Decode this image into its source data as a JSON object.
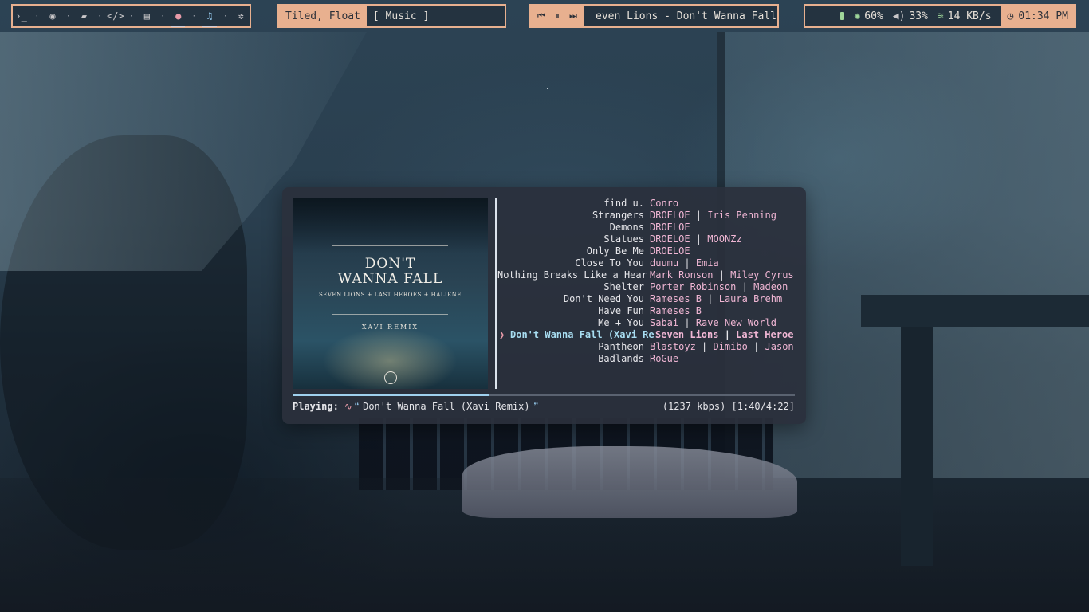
{
  "workspaces": {
    "items": [
      {
        "icon": "terminal-icon",
        "glyph": "›_"
      },
      {
        "icon": "browser-icon",
        "glyph": "◉"
      },
      {
        "icon": "folder-icon",
        "glyph": "▰"
      },
      {
        "icon": "code-icon",
        "glyph": "</>"
      },
      {
        "icon": "book-icon",
        "glyph": "▤"
      },
      {
        "icon": "chat-icon",
        "glyph": "●"
      },
      {
        "icon": "music-icon",
        "glyph": "♫"
      },
      {
        "icon": "gear-icon",
        "glyph": "✲"
      }
    ],
    "separator": "·"
  },
  "layout_bar": {
    "mode": "Tiled, Float",
    "window_title": "[ Music ]"
  },
  "player_bar": {
    "prev": "⏮",
    "pause": "⏸",
    "next": "⏭",
    "now_playing": "even Lions - Don't Wanna Fall ("
  },
  "status_bar": {
    "battery": "60%",
    "volume": "33%",
    "network": "14 KB/s",
    "clock": "01:34 PM",
    "icons": {
      "brightness": "✺",
      "volume": "◀)",
      "wifi": "≋",
      "clock": "◷"
    }
  },
  "cover_art": {
    "title_line1": "DON'T",
    "title_line2": "WANNA FALL",
    "artists": "SEVEN LIONS + LAST HEROES + HALIENE",
    "remix": "XAVI REMIX"
  },
  "playlist": {
    "rows": [
      {
        "title": "find u.",
        "artists": [
          "Conro"
        ],
        "current": false
      },
      {
        "title": "Strangers",
        "artists": [
          "DROELOE",
          "Iris Penning"
        ],
        "current": false
      },
      {
        "title": "Demons",
        "artists": [
          "DROELOE"
        ],
        "current": false
      },
      {
        "title": "Statues",
        "artists": [
          "DROELOE",
          "MOONZz"
        ],
        "current": false
      },
      {
        "title": "Only Be Me",
        "artists": [
          "DROELOE"
        ],
        "current": false
      },
      {
        "title": "Close To You",
        "artists": [
          "duumu",
          "Emia"
        ],
        "current": false
      },
      {
        "title": "Nothing Breaks Like a Hear",
        "artists": [
          "Mark Ronson",
          "Miley Cyrus"
        ],
        "current": false
      },
      {
        "title": "Shelter",
        "artists": [
          "Porter Robinson",
          "Madeon"
        ],
        "current": false
      },
      {
        "title": "Don't Need You",
        "artists": [
          "Rameses B",
          "Laura Brehm"
        ],
        "current": false
      },
      {
        "title": "Have Fun",
        "artists": [
          "Rameses B"
        ],
        "current": false
      },
      {
        "title": "Me + You",
        "artists": [
          "Sabai",
          "Rave New World"
        ],
        "current": false
      },
      {
        "title": "Don't Wanna Fall (Xavi Re",
        "artists": [
          "Seven Lions",
          "Last Heroe"
        ],
        "current": true
      },
      {
        "title": "Pantheon",
        "artists": [
          "Blastoyz",
          "Dimibo",
          "Jason"
        ],
        "current": false
      },
      {
        "title": "Badlands",
        "artists": [
          "RoGue"
        ],
        "current": false
      }
    ],
    "current_marker": "❯",
    "artist_separator": " | "
  },
  "playback": {
    "label": "Playing:",
    "pulse_icon": "∿",
    "open_quote": "❝",
    "song": "Don't Wanna Fall (Xavi Remix)",
    "close_quote": "❞",
    "info": "(1237 kbps) [1:40/4:22]",
    "progress": 0.39
  }
}
